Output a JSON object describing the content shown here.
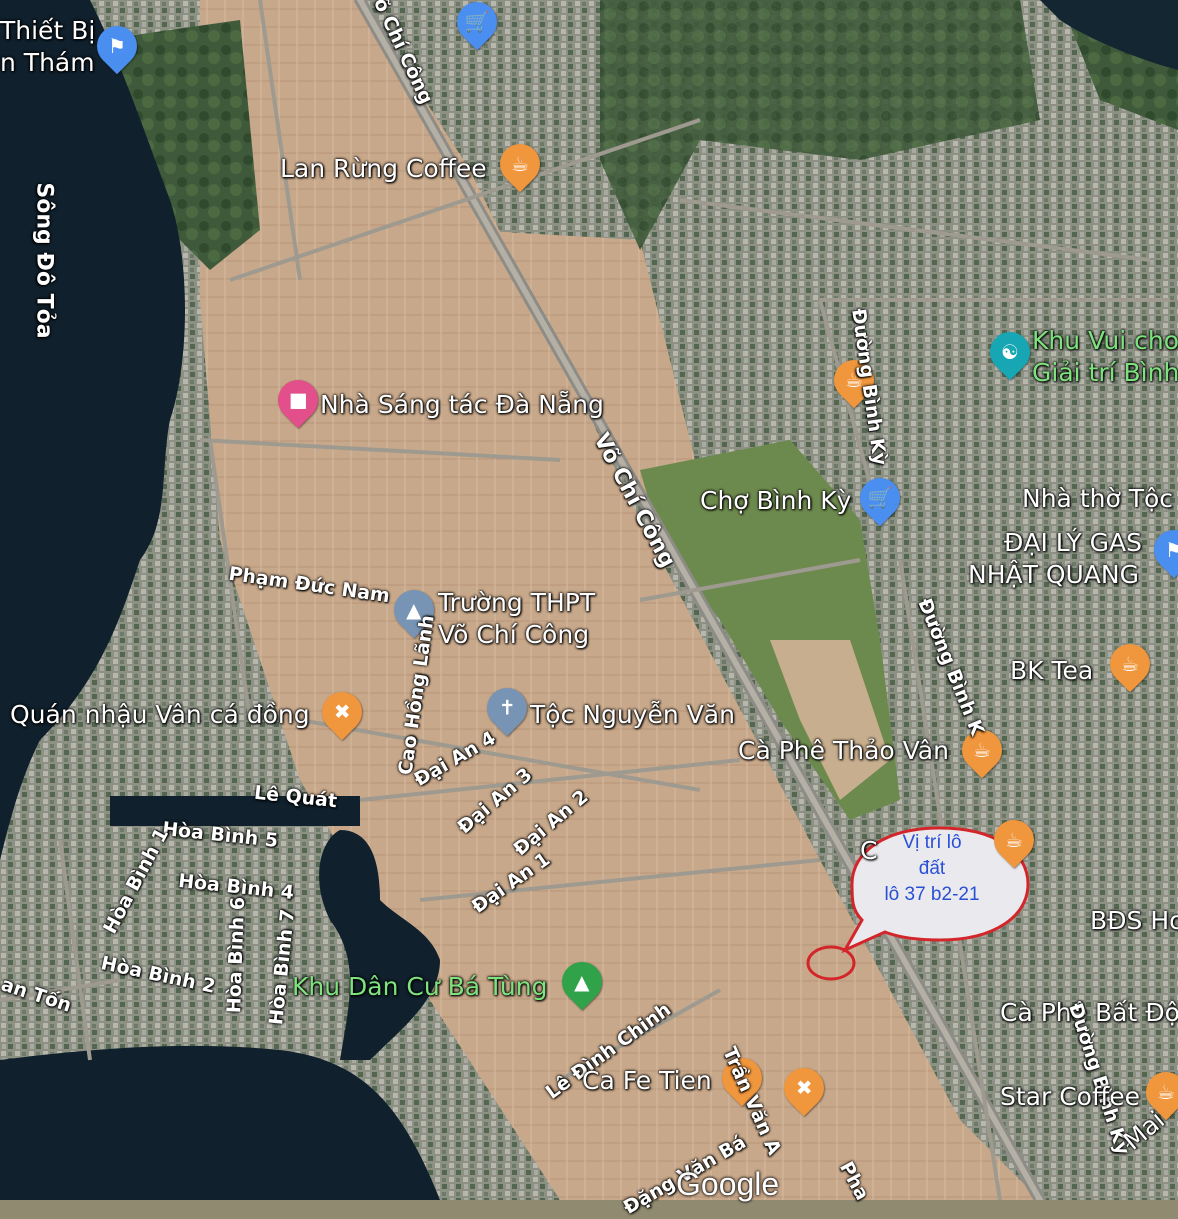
{
  "labels": {
    "thiet_bi": "Thiết Bị",
    "tham": "n Thám",
    "song_do_toa": "Sông Đô Tỏa",
    "vo_chi_cong_top": "õ Chí Công",
    "lan_rung_coffee": "Lan Rừng Coffee",
    "khu_vui_choi": "Khu Vui cho",
    "giai_tri_binh": "Giải trí Bình",
    "duong_binh_ky_top": "Đường Bình Kỳ",
    "nha_sang_tac": "Nhà Sáng tác Đà Nẵng",
    "vo_chi_cong_mid": "Võ Chí Công",
    "cho_binh_ky": "Chợ Bình Kỳ",
    "nha_tho_toc": "Nhà thờ Tộc",
    "dai_ly_gas": "ĐẠI LÝ GAS",
    "nhat_quang": "NHẬT QUANG",
    "pham_duc_nam": "Phạm Đức Nam",
    "truong_thpt": "Trường THPT",
    "vo_chi_cong_school": "Võ Chí Công",
    "duong_binh_ky_mid": "Đường Bình K",
    "bk_tea": "BK Tea",
    "cao_hong_lanh": "Cao Hồng Lãnh",
    "quan_nhau": "Quán nhậu Vân cá đồng",
    "toc_nguyen_van": "Tộc Nguyễn Văn",
    "ca_phe_thao_van": "Cà Phê Thảo Vân",
    "dai_an_4": "Đại An 4",
    "dai_an_3": "Đại An 3",
    "dai_an_2": "Đại An 2",
    "dai_an_1": "Đại An 1",
    "le_quat": "Lê Quát",
    "hoa_binh_5": "Hòa Bình 5",
    "hoa_binh_1": "Hòa Bình 1",
    "hoa_binh_4": "Hòa Bình 4",
    "hoa_binh_6": "Hòa Bình 6",
    "hoa_binh_7": "Hòa Bình 7",
    "hoa_binh_2": "Hòa Bình 2",
    "an_ton": "an Tốn",
    "khu_dan_cu": "Khu Dân Cư Bá Tùng",
    "bds_ho": "BĐS Ho",
    "ca_phe_bat_dong": "Cà Phê Bất Độ",
    "duong_binh_ky_low": "Đường Bình Kỳ",
    "le_dinh_chinh": "Lê Đình Chinh",
    "ca_fe_tien": "Ca Fe Tien",
    "tran_van_a": "Trần Văn A",
    "dang_van_ba": "Đặng Văn Bá",
    "star_coffee": "Star Coffee",
    "mai": "Mai",
    "pha": "Pha",
    "c_partial": "C"
  },
  "callout": {
    "line1": "Vị trí lô",
    "line2": "đất",
    "line3": "lô 37 b2-21"
  },
  "attribution": "Google",
  "colors": {
    "callout_border": "#d3262a",
    "callout_fill": "#e9e9ee",
    "callout_text": "#2a50d6",
    "water": "#10202c",
    "orange_pin": "#f0963c",
    "blue_pin": "#4a8ff0"
  }
}
